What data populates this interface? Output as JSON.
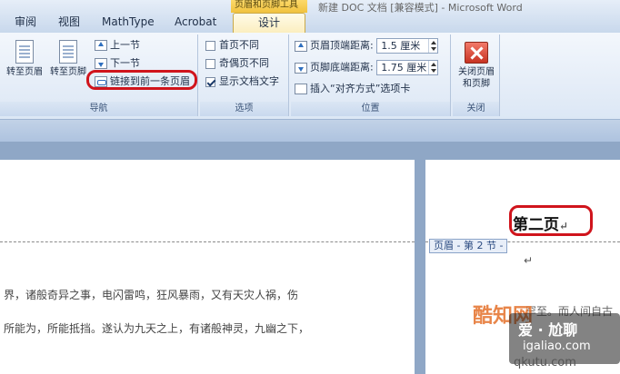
{
  "window": {
    "title": "新建 DOC 文档 [兼容模式] - Microsoft Word",
    "context_tab_header": "页眉和页脚工具"
  },
  "tabs": [
    {
      "label": "审阅"
    },
    {
      "label": "视图"
    },
    {
      "label": "MathType"
    },
    {
      "label": "Acrobat"
    },
    {
      "label": "设计"
    }
  ],
  "ribbon": {
    "nav": {
      "goto_header": "转至页眉",
      "goto_footer": "转至页脚",
      "prev_section": "上一节",
      "next_section": "下一节",
      "link_previous": "链接到前一条页眉",
      "group_label": "导航"
    },
    "options": {
      "first_page_diff": "首页不同",
      "odd_even_diff": "奇偶页不同",
      "show_doc_text": "显示文档文字",
      "group_label": "选项"
    },
    "position": {
      "header_from_top_label": "页眉顶端距离:",
      "header_from_top_value": "1.5 厘米",
      "footer_from_bottom_label": "页脚底端距离:",
      "footer_from_bottom_value": "1.75 厘米",
      "insert_align_tab": "插入“对齐方式”选项卡",
      "group_label": "位置"
    },
    "close": {
      "close_label_1": "关闭页眉",
      "close_label_2": "和页脚",
      "group_label": "关闭"
    }
  },
  "document": {
    "left_page": {
      "line1": "界，诸般奇异之事，电闪雷鸣，狂风暴雨，又有天灾人祸，伤",
      "line2": "所能为，所能抵挡。遂认为九天之上，有诸般神灵，九幽之下，"
    },
    "right_page": {
      "heading": "第二页",
      "header_tag": "页眉 - 第 2 节 -",
      "body": "罕至。而人间自古"
    }
  },
  "watermark": {
    "brand": "酷知网",
    "overlay_text": "爱 · 尬聊",
    "domain": "igaliao.com",
    "domain2": "qkutu.com"
  }
}
